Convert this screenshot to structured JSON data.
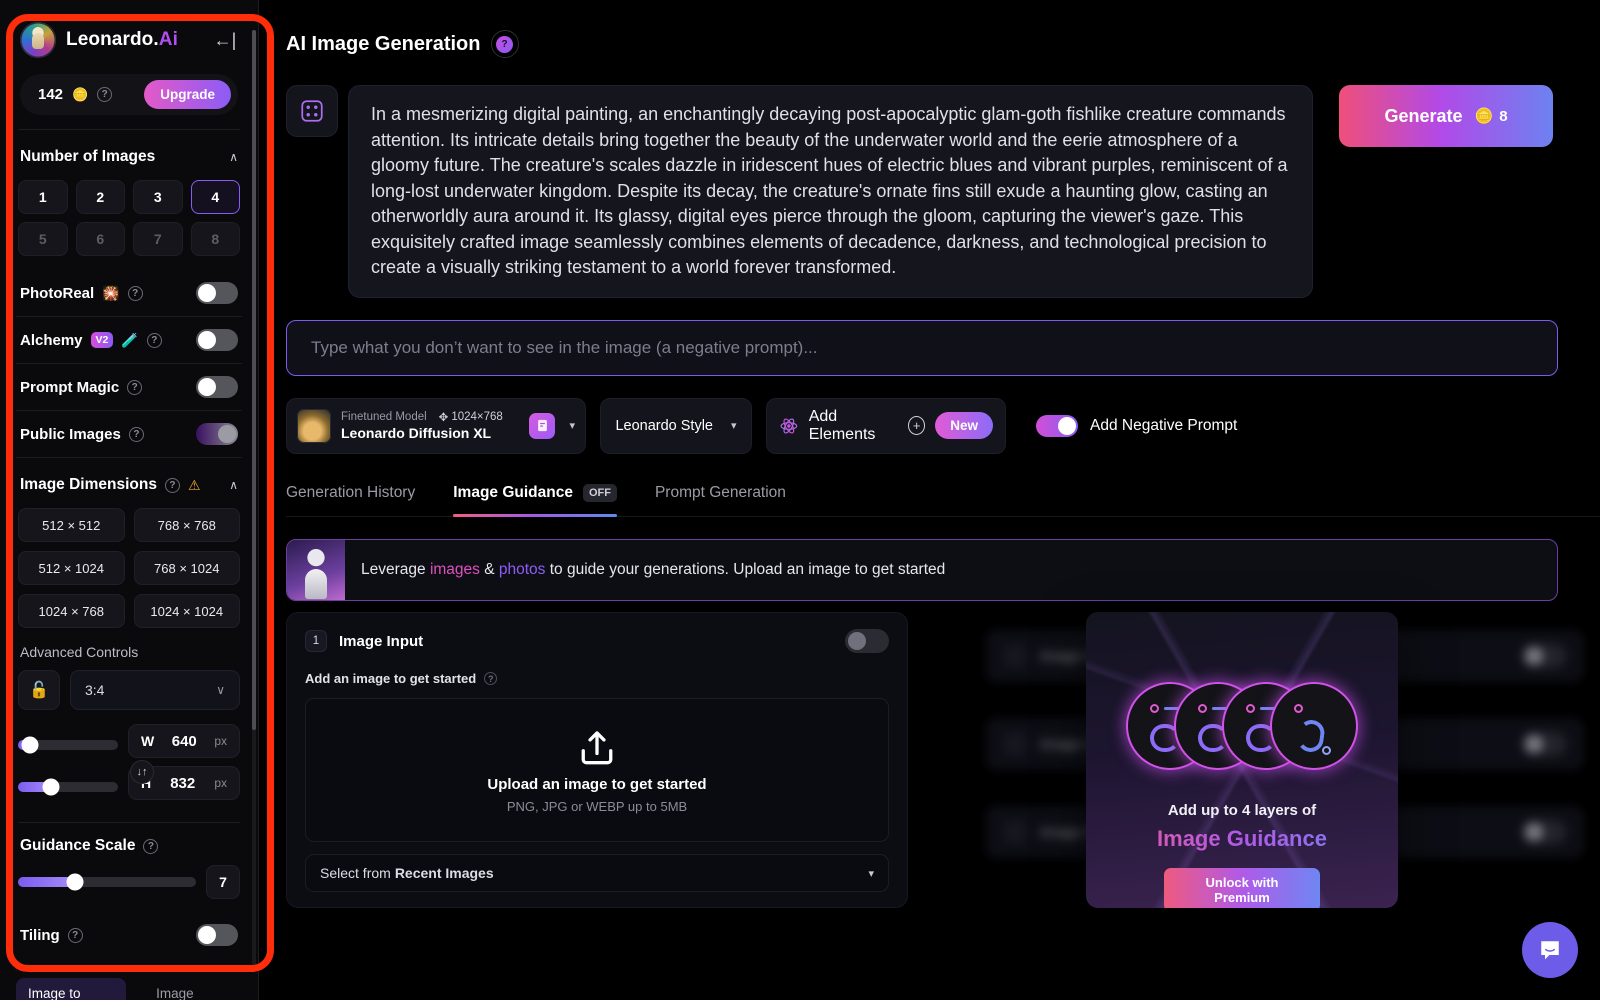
{
  "sidebar": {
    "brand": {
      "name_main": "Leonardo.",
      "name_accent": "Ai",
      "collapse_icon": "←|"
    },
    "credits": {
      "amount": "142",
      "coin_icon": "🪙",
      "help": "?",
      "upgrade_label": "Upgrade"
    },
    "number_of_images": {
      "title": "Number of Images",
      "chevron": "∧",
      "options": [
        "1",
        "2",
        "3",
        "4",
        "5",
        "6",
        "7",
        "8"
      ],
      "selected": "4",
      "disabled": [
        "5",
        "6",
        "7",
        "8"
      ]
    },
    "toggles": [
      {
        "label": "PhotoReal",
        "emoji": "🎇",
        "help": "?",
        "state": "off"
      },
      {
        "label": "Alchemy",
        "badge": "V2",
        "emoji": "🧪",
        "help": "?",
        "state": "off"
      },
      {
        "label": "Prompt Magic",
        "help": "?",
        "state": "off"
      },
      {
        "label": "Public Images",
        "help": "?",
        "state": "on"
      }
    ],
    "image_dimensions": {
      "title": "Image Dimensions",
      "help": "?",
      "warning_icon": "⚠",
      "chevron": "∧",
      "presets": [
        "512 × 512",
        "768 × 768",
        "512 × 1024",
        "768 × 1024",
        "1024 × 768",
        "1024 × 1024"
      ]
    },
    "advanced_controls": {
      "label": "Advanced Controls",
      "lock_icon": "🔓",
      "aspect_ratio": "3:4",
      "ratio_chevron": "∨",
      "swap_icon": "↓↑",
      "width": {
        "key": "W",
        "value": "640",
        "unit": "px",
        "slider_pct": 12
      },
      "height": {
        "key": "H",
        "value": "832",
        "unit": "px",
        "slider_pct": 33
      }
    },
    "guidance_scale": {
      "title": "Guidance Scale",
      "help": "?",
      "value": "7",
      "slider_pct": 32
    },
    "tiling": {
      "label": "Tiling",
      "help": "?",
      "state": "off"
    },
    "bottom_tabs": [
      {
        "label": "Image to Image",
        "active": true
      },
      {
        "label": "Image Prompt",
        "active": false
      }
    ]
  },
  "main": {
    "page_title": "AI Image Generation",
    "help_badge": "?",
    "dice_icon": "⚂",
    "prompt": "In a mesmerizing digital painting, an enchantingly decaying post-apocalyptic glam-goth fishlike creature commands attention. Its intricate details bring together the beauty of the underwater world and the eerie atmosphere of a gloomy future. The creature's scales dazzle in iridescent hues of electric blues and vibrant purples, reminiscent of a long-lost underwater kingdom. Despite its decay, the creature's ornate fins still exude a haunting glow, casting an otherworldly aura around it. Its glassy, digital eyes pierce through the gloom, capturing the viewer's gaze. This exquisitely crafted image seamlessly combines elements of decadence, darkness, and technological precision to create a visually striking testament to a world forever transformed.",
    "generate": {
      "label": "Generate",
      "cost": "8",
      "coin_icon": "🪙"
    },
    "negative_prompt_placeholder": "Type what you don’t want to see in the image (a negative prompt)...",
    "model_card": {
      "kicker": "Finetuned Model",
      "resolution": "1024×768",
      "move_icon": "✥",
      "name": "Leonardo Diffusion XL",
      "caret": "▾"
    },
    "style_card": {
      "label": "Leonardo Style",
      "caret": "▾"
    },
    "elements_card": {
      "label": "Add Elements",
      "plus": "+",
      "badge": "New",
      "atom_icon": "atom"
    },
    "negative_toggle": {
      "label": "Add Negative Prompt",
      "state": "on"
    },
    "tabs": [
      {
        "label": "Generation History",
        "active": false
      },
      {
        "label": "Image Guidance",
        "active": true,
        "badge": "OFF"
      },
      {
        "label": "Prompt Generation",
        "active": false
      }
    ],
    "banner": {
      "pre": "Leverage ",
      "hl1": "images",
      "amp": " & ",
      "hl2": "photos",
      "post": " to guide your generations. Upload an image to get started"
    },
    "image_input": {
      "number": "1",
      "title": "Image Input",
      "toggle_state": "off",
      "sub_label": "Add an image to get started",
      "sub_help": "?",
      "upload_icon": "upload",
      "dropzone_title": "Upload an image to get started",
      "dropzone_sub": "PNG, JPG or WEBP up to 5MB",
      "recent_pre": "Select from ",
      "recent_bold": "Recent Images",
      "recent_chevron": "▾"
    },
    "blurred_rows": [
      {
        "label": "Image Input"
      },
      {
        "label": "Image Input"
      },
      {
        "label": "Image Input"
      }
    ],
    "premium_card": {
      "line1": "Add up to 4 layers of",
      "line2": "Image Guidance",
      "button": "Unlock with Premium"
    },
    "chat_fab_icon": "chat-bubble"
  },
  "colors": {
    "accent_purple": "#8b5cf6",
    "accent_pink": "#e04fc0",
    "gradient_start": "#ef4f7a",
    "gradient_mid": "#b14ae8",
    "gradient_end": "#6d82f0",
    "annotation_red": "#ff2d0a",
    "warning_amber": "#f0a92e",
    "chat_fab": "#6c5ce7"
  }
}
